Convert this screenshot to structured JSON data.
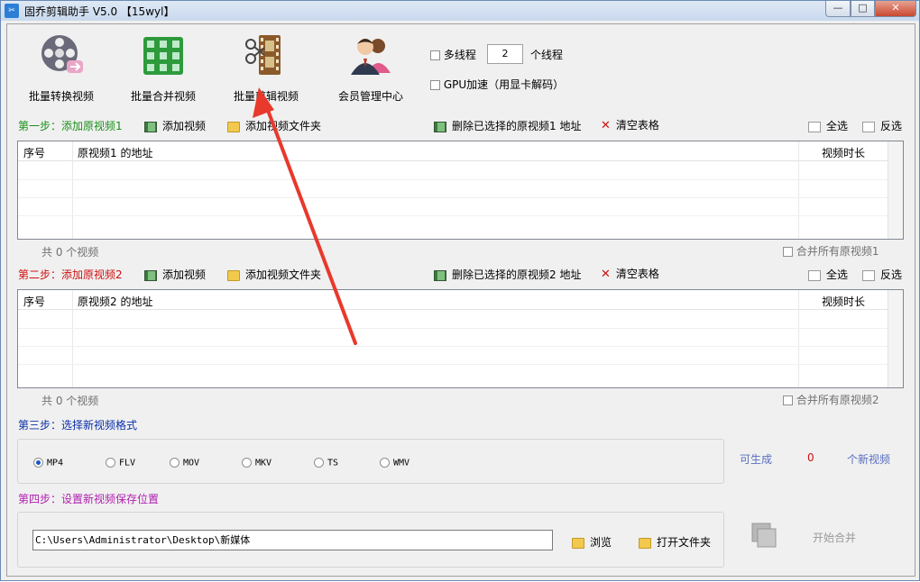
{
  "window": {
    "title": "固乔剪辑助手 V5.0 【15wyl】",
    "app_icon_text": "✂",
    "min": "—",
    "max": "□",
    "close": "✕"
  },
  "toolbar": {
    "batch_convert": "批量转换视频",
    "batch_merge": "批量合并视频",
    "batch_cut": "批量剪辑视频",
    "member": "会员管理中心",
    "multithread_label": "多线程",
    "thread_count": "2",
    "thread_unit": "个线程",
    "gpu_label": "GPU加速（用显卡解码）"
  },
  "step1": {
    "prefix": "第一步：",
    "title": "添加原视频1",
    "add_video": "添加视频",
    "add_folder": "添加视频文件夹",
    "delete_selected": "删除已选择的原视频1 地址",
    "clear": "清空表格",
    "select_all": "全选",
    "invert": "反选",
    "col_index": "序号",
    "col_path": "原视频1 的地址",
    "col_duration": "视频时长",
    "count": "共 0 个视频",
    "merge_all": "合并所有原视频1"
  },
  "step2": {
    "prefix": "第二步：",
    "title": "添加原视频2",
    "add_video": "添加视频",
    "add_folder": "添加视频文件夹",
    "delete_selected": "删除已选择的原视频2 地址",
    "clear": "清空表格",
    "select_all": "全选",
    "invert": "反选",
    "col_index": "序号",
    "col_path": "原视频2 的地址",
    "col_duration": "视频时长",
    "count": "共 0 个视频",
    "merge_all": "合并所有原视频2"
  },
  "step3": {
    "title": "第三步：选择新视频格式",
    "formats": [
      "MP4",
      "FLV",
      "MOV",
      "MKV",
      "TS",
      "WMV"
    ],
    "selected": "MP4",
    "can_generate": "可生成",
    "generate_count": "0",
    "new_videos": "个新视频"
  },
  "step4": {
    "title": "第四步：设置新视频保存位置",
    "path": "C:\\Users\\Administrator\\Desktop\\新媒体",
    "browse": "浏览",
    "open_folder": "打开文件夹",
    "start": "开始合并"
  },
  "colors": {
    "arrow": "#e8392c",
    "step1": "#1a8f1a",
    "step2": "#d01010",
    "step3": "#0a2fa8",
    "step4": "#b020b0"
  }
}
